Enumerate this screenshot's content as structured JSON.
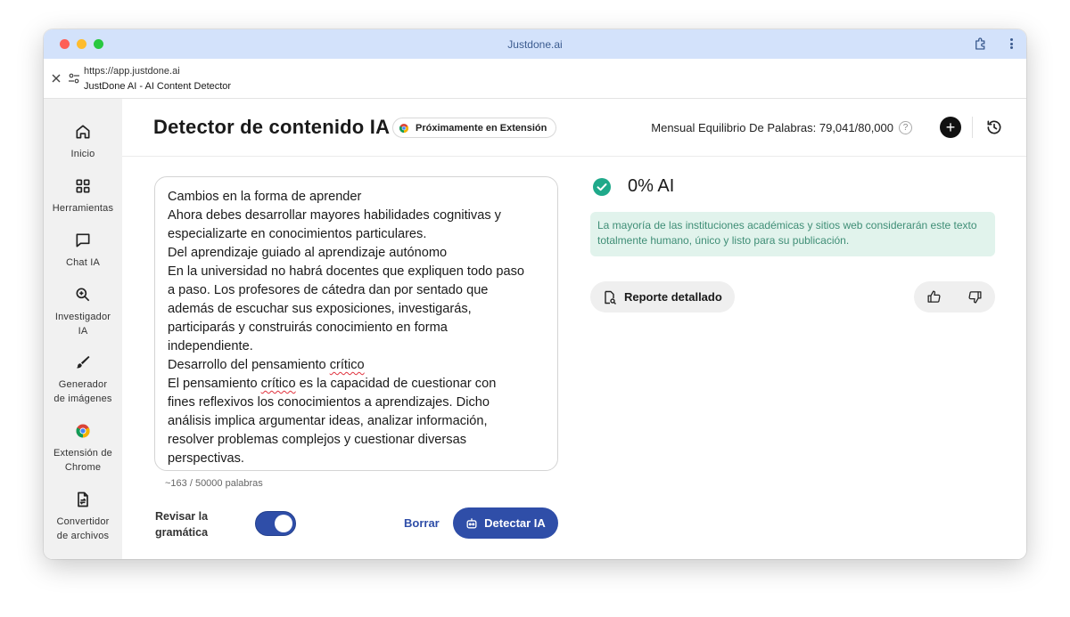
{
  "browser": {
    "window_title": "Justdone.ai",
    "url": "https://app.justdone.ai",
    "page_title": "JustDone AI - AI Content Detector"
  },
  "sidebar": {
    "items": [
      {
        "label": "Inicio",
        "icon": "home-icon"
      },
      {
        "label": "Herramientas",
        "icon": "grid-icon"
      },
      {
        "label": "Chat IA",
        "icon": "chat-icon"
      },
      {
        "label": "Investigador\nIA",
        "icon": "search-icon"
      },
      {
        "label": "Generador\nde imágenes",
        "icon": "brush-icon"
      },
      {
        "label": "Extensión de\nChrome",
        "icon": "chrome-icon"
      },
      {
        "label": "Convertidor\nde archivos",
        "icon": "file-convert-icon"
      }
    ]
  },
  "header": {
    "title": "Detector de contenido IA",
    "extension_badge": "Próximamente en Extensión",
    "balance_label": "Mensual Equilibrio De Palabras: 79,041/80,000",
    "help": "?",
    "add": "+"
  },
  "editor": {
    "lines": {
      "l1": "Cambios en la forma de aprender",
      "l2": "Ahora debes desarrollar mayores habilidades cognitivas y",
      "l3": "especializarte en conocimientos particulares.",
      "l4": "Del aprendizaje guiado al aprendizaje autónomo",
      "l5": "En la universidad no habrá docentes que expliquen todo paso",
      "l6": "a paso. Los profesores de cátedra dan por sentado que",
      "l7": "además de escuchar sus exposiciones, investigarás,",
      "l8": "participarás y construirás conocimiento en forma",
      "l9": "independiente.",
      "l10_a": "Desarrollo del pensamiento ",
      "l10_b": "crítico",
      "l11_a": "El pensamiento ",
      "l11_b": "crítico",
      "l11_c": " es la capacidad de cuestionar con",
      "l12": "fines reflexivos los conocimientos a aprendizajes. Dicho",
      "l13": "análisis implica argumentar ideas, analizar información,",
      "l14": "resolver problemas complejos y cuestionar diversas",
      "l15": "perspectivas."
    },
    "word_count": "~163 / 50000 palabras"
  },
  "controls": {
    "grammar_label": "Revisar la gramática",
    "grammar_enabled": true,
    "clear_label": "Borrar",
    "detect_label": "Detectar IA"
  },
  "result": {
    "score": "0% AI",
    "note": "La mayoría de las instituciones académicas y sitios web considerarán este texto totalmente humano, único y listo para su publicación.",
    "report_label": "Reporte detallado"
  },
  "colors": {
    "accent": "#2f4ea8",
    "success": "#1fa98a",
    "note_bg": "#e1f3ec",
    "titlebar": "#d3e2fb"
  }
}
